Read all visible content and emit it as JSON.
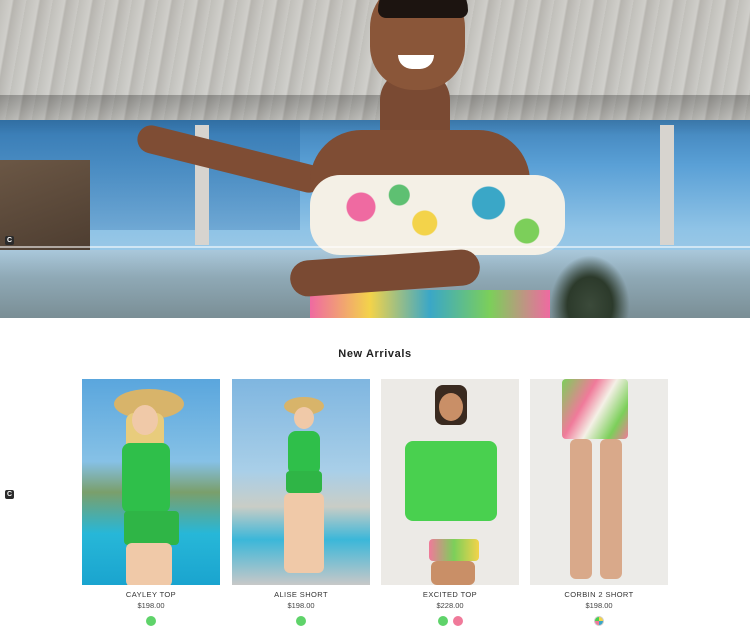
{
  "section": {
    "title": "New Arrivals"
  },
  "chat_badge_glyph": "C",
  "products": [
    {
      "name": "CAYLEY TOP",
      "price": "$198.00",
      "swatches": [
        "#5fd36a"
      ]
    },
    {
      "name": "ALISE SHORT",
      "price": "$198.00",
      "swatches": [
        "#5fd36a"
      ]
    },
    {
      "name": "EXCITED TOP",
      "price": "$228.00",
      "swatches": [
        "#5fd36a",
        "#f07a9a"
      ]
    },
    {
      "name": "CORBIN 2 SHORT",
      "price": "$198.00",
      "swatches": [
        "multicolor"
      ]
    }
  ],
  "colors": {
    "swatch_green": "#5fd36a",
    "swatch_pink": "#f07a9a",
    "garment_green": "#2fbf4a"
  }
}
